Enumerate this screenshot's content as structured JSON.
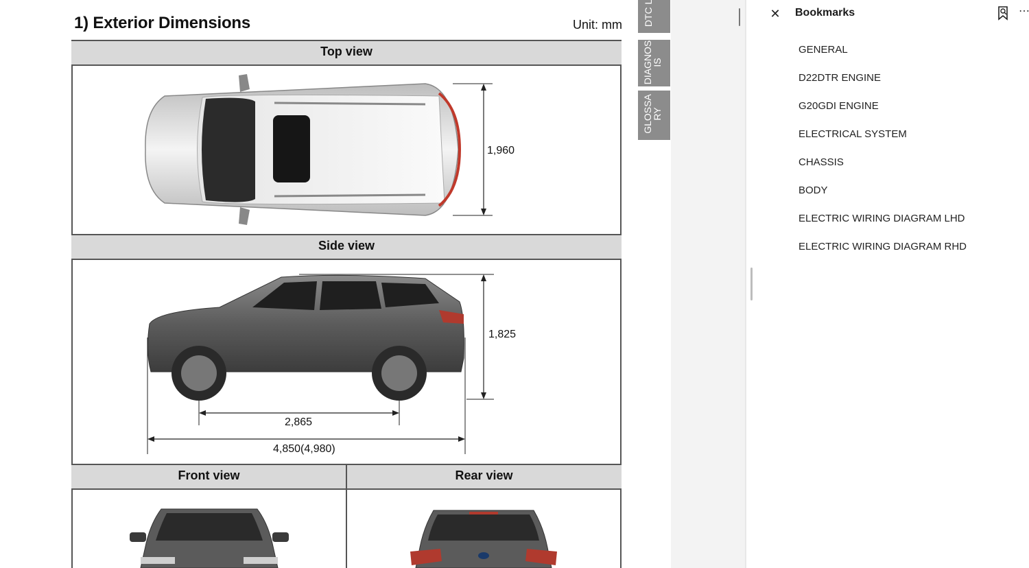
{
  "document": {
    "title": "1) Exterior Dimensions",
    "unit": "Unit: mm",
    "views": {
      "top": "Top view",
      "side": "Side view",
      "front": "Front view",
      "rear": "Rear view"
    },
    "dimensions": {
      "width": "1,960",
      "height": "1,825",
      "wheelbase": "2,865",
      "length": "4,850(4,980)"
    }
  },
  "side_tabs": [
    {
      "label": "DTC LI"
    },
    {
      "label": "DIAGNOS\nIS"
    },
    {
      "label": "GLOSSA\nRY"
    }
  ],
  "bookmarks": {
    "title": "Bookmarks",
    "close_icon": "close-icon",
    "more_icon": "more-options-icon",
    "items": [
      {
        "label": "GENERAL"
      },
      {
        "label": "D22DTR ENGINE"
      },
      {
        "label": "G20GDI ENGINE"
      },
      {
        "label": "ELECTRICAL SYSTEM"
      },
      {
        "label": "CHASSIS"
      },
      {
        "label": "BODY"
      },
      {
        "label": "ELECTRIC WIRING DIAGRAM LHD"
      },
      {
        "label": "ELECTRIC WIRING DIAGRAM RHD"
      }
    ]
  }
}
